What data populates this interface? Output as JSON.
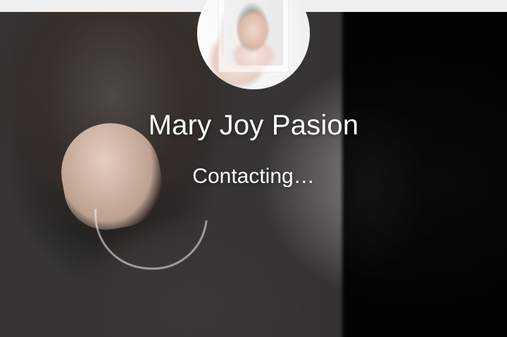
{
  "call": {
    "contact_name": "Mary Joy Pasion",
    "status": "Contacting…"
  }
}
